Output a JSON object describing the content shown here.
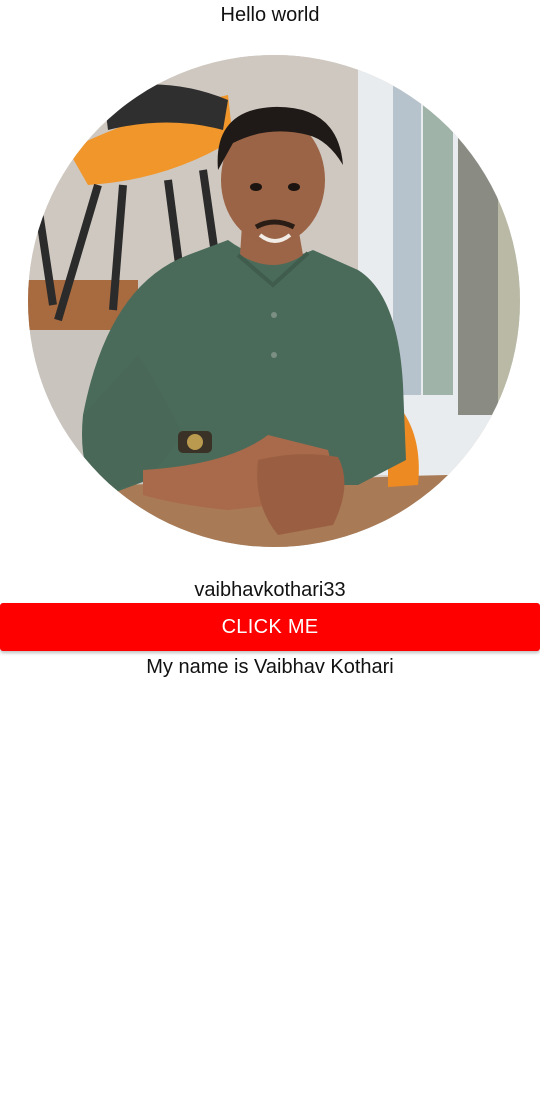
{
  "header": {
    "title": "Hello world"
  },
  "profile": {
    "photo_icon": "profile-photo",
    "username": "vaibhavkothari33",
    "bio": "My name is Vaibhav Kothari"
  },
  "actions": {
    "click_label": "CLICK ME"
  },
  "colors": {
    "button_bg": "#ff0000",
    "button_text": "#ffffff",
    "background": "#ffffff",
    "text": "#111111"
  }
}
